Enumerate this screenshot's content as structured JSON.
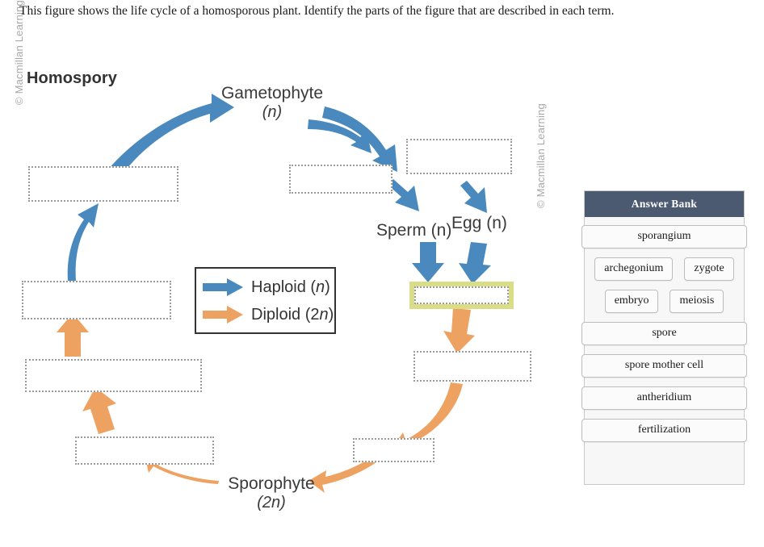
{
  "prompt": "This figure shows the life cycle of a homosporous plant. Identify the parts of the figure that are described in each term.",
  "watermark_left": "© Macmillan Learning",
  "watermark_right": "© Macmillan Learning",
  "figure": {
    "title": "Homospory",
    "labels": {
      "gametophyte": "Gametophyte",
      "gametophyte_ploidy": "(n)",
      "sperm": "Sperm (n)",
      "egg": "Egg (n)",
      "sporophyte": "Sporophyte",
      "sporophyte_ploidy": "(2n)"
    },
    "legend": {
      "haploid_label": "Haploid (n)",
      "haploid_color": "#4a89bd",
      "diploid_label": "Diploid (2n)",
      "diploid_color": "#eea262"
    },
    "drop_targets": [
      {
        "id": "dz-left-top",
        "value": "",
        "state": "empty"
      },
      {
        "id": "dz-left-mid",
        "value": "",
        "state": "empty"
      },
      {
        "id": "dz-left-lower",
        "value": "",
        "state": "empty"
      },
      {
        "id": "dz-left-bottom",
        "value": "",
        "state": "empty"
      },
      {
        "id": "dz-center-upper",
        "value": "",
        "state": "empty"
      },
      {
        "id": "dz-right-upper",
        "value": "",
        "state": "empty"
      },
      {
        "id": "dz-zygote",
        "value": "",
        "state": "highlighted"
      },
      {
        "id": "dz-right-mid",
        "value": "",
        "state": "empty"
      },
      {
        "id": "dz-right-lower",
        "value": "",
        "state": "empty"
      }
    ]
  },
  "answer_bank": {
    "title": "Answer Bank",
    "header_color": "#4b5a70",
    "items": [
      "sporangium",
      "archegonium",
      "zygote",
      "embryo",
      "meiosis",
      "spore",
      "spore mother cell",
      "antheridium",
      "fertilization"
    ]
  }
}
